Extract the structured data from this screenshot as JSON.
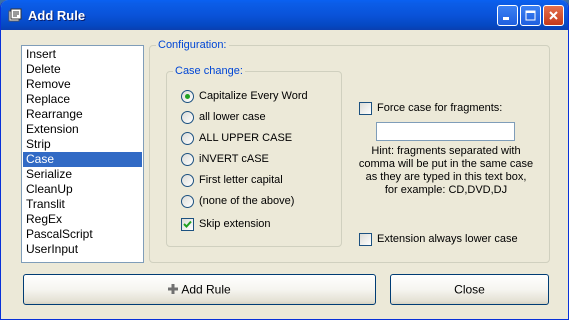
{
  "window": {
    "title": "Add Rule",
    "icon": "app-icon",
    "controls": [
      "minimize-icon",
      "maximize-icon",
      "close-icon"
    ]
  },
  "rules_list": {
    "selected": "Case",
    "items": [
      "Insert",
      "Delete",
      "Remove",
      "Replace",
      "Rearrange",
      "Extension",
      "Strip",
      "Case",
      "Serialize",
      "CleanUp",
      "Translit",
      "RegEx",
      "PascalScript",
      "UserInput"
    ]
  },
  "configuration": {
    "legend": "Configuration:",
    "case_change": {
      "legend": "Case change:",
      "options": [
        "Capitalize Every Word",
        "all lower case",
        "ALL UPPER CASE",
        "iNVERT cASE",
        "First letter capital",
        "(none of the above)"
      ],
      "selected": "Capitalize Every Word"
    },
    "skip_extension": {
      "label": "Skip extension",
      "checked": true
    },
    "force_case": {
      "label": "Force case for fragments:",
      "checked": false
    },
    "fragments_value": "",
    "hint": "Hint: fragments separated with comma will be put in the same case as they are typed in this text box, for example: CD,DVD,DJ",
    "extension_lower": {
      "label": "Extension always lower case",
      "checked": false
    }
  },
  "buttons": {
    "add_rule": "Add Rule",
    "add_rule_icon": "plus-icon",
    "close": "Close"
  },
  "colors": {
    "titlebar": "#0a53d9",
    "selection": "#316ac5",
    "legend_text": "#0046d5",
    "radio_dot": "#21a121",
    "check_mark": "#21a121"
  }
}
